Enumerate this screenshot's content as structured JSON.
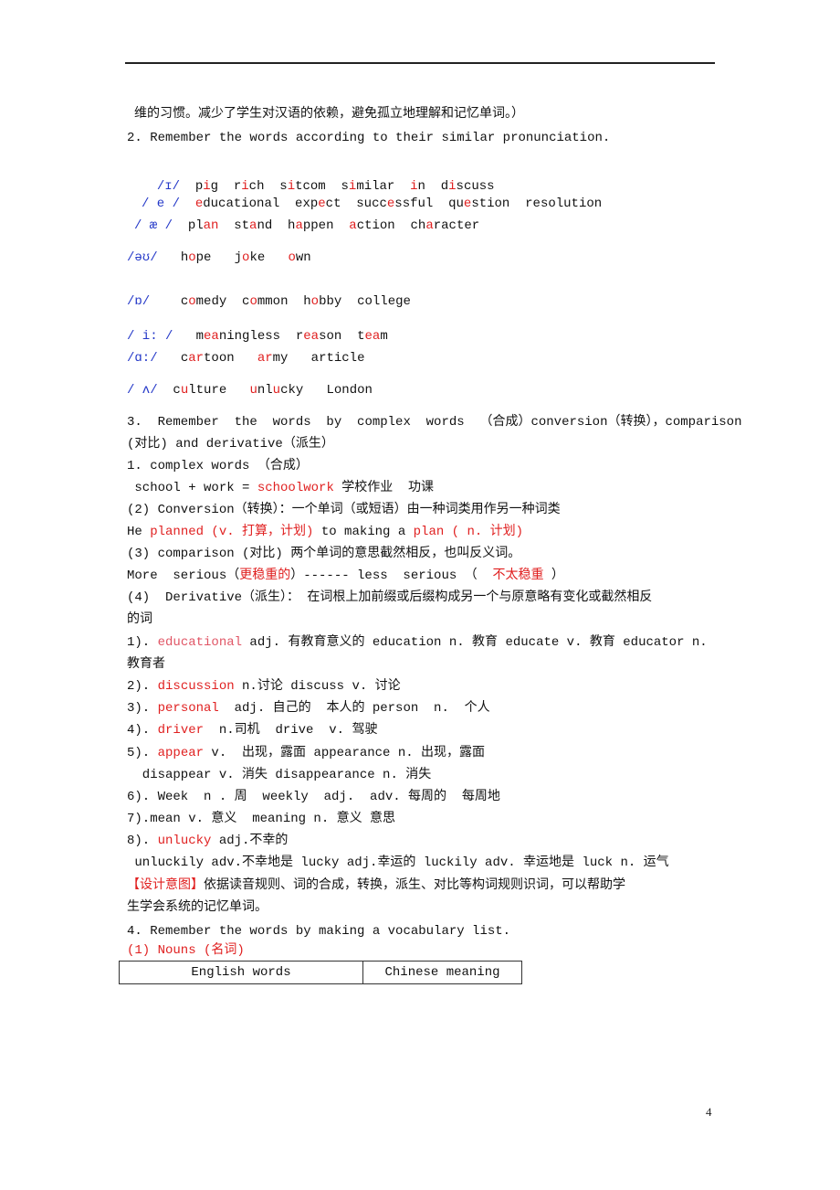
{
  "intro_tail": "维的习惯。减少了学生对汉语的依赖，避免孤立地理解和记忆单词。）",
  "section2": {
    "title": "2. Remember the words according to their similar pronunciation.",
    "rows": [
      {
        "symbol": "/ɪ/",
        "words": [
          [
            "p",
            "i",
            "g"
          ],
          [
            "r",
            "i",
            "ch"
          ],
          [
            "s",
            "i",
            "tcom"
          ],
          [
            "s",
            "i",
            "milar"
          ],
          [
            "",
            "i",
            "n"
          ],
          [
            "d",
            "i",
            "scuss"
          ]
        ]
      },
      {
        "symbol": "/ e /",
        "words": [
          [
            "",
            "e",
            "ducational"
          ],
          [
            "exp",
            "e",
            "ct"
          ],
          [
            "succ",
            "e",
            "ssful"
          ],
          [
            "qu",
            "e",
            "stion"
          ],
          [
            "resolution",
            "",
            ""
          ]
        ]
      },
      {
        "symbol": "/ æ /",
        "words": [
          [
            "pl",
            "an",
            ""
          ],
          [
            "st",
            "a",
            "nd"
          ],
          [
            "h",
            "a",
            "ppen"
          ],
          [
            "",
            "a",
            "ction"
          ],
          [
            "ch",
            "a",
            "racter"
          ]
        ]
      },
      {
        "symbol": "/əʊ/",
        "words": [
          [
            "h",
            "o",
            "pe"
          ],
          [
            "j",
            "o",
            "ke"
          ],
          [
            "",
            "o",
            "wn"
          ]
        ]
      },
      {
        "symbol": "/ɒ/",
        "words": [
          [
            "c",
            "o",
            "medy"
          ],
          [
            "c",
            "o",
            "mmon"
          ],
          [
            "h",
            "o",
            "bby"
          ],
          [
            "college",
            "",
            ""
          ]
        ]
      },
      {
        "symbol": "/ i: /",
        "words": [
          [
            "m",
            "ea",
            "ningless"
          ],
          [
            "r",
            "ea",
            "son"
          ],
          [
            "t",
            "ea",
            "m"
          ]
        ]
      },
      {
        "symbol": "/ɑ:/",
        "words": [
          [
            "c",
            "ar",
            "toon"
          ],
          [
            "",
            "ar",
            "my"
          ],
          [
            "article",
            "",
            ""
          ]
        ]
      },
      {
        "symbol": "/ ʌ/",
        "words": [
          [
            "c",
            "u",
            "lture"
          ],
          [
            "",
            "u",
            "nl"
          ],
          [
            "u",
            "",
            ""
          ],
          [
            "London",
            "",
            ""
          ]
        ]
      }
    ]
  },
  "section3": {
    "title_line1": "3.  Remember  the  words  by  complex  words  （合成）conversion（转换），comparison",
    "title_line2": "(对比) and derivative（派生）",
    "complex_heading": "1. complex words （合成）",
    "complex_example": {
      "pre": " school + work = ",
      "red": "schoolwork",
      "post": " 学校作业  功课"
    },
    "conversion_heading": "(2) Conversion（转换）：一个单词（或短语）由一种词类用作另一种词类",
    "conversion_example": {
      "pre": "He ",
      "red1": "planned (v. 打算，计划)",
      "mid": " to making a ",
      "red2": "plan ( n. 计划)"
    },
    "comparison_heading": "(3) comparison (对比) 两个单词的意思截然相反，也叫反义词。",
    "comparison_example": {
      "pre": "More  serious（",
      "red1": "更稳重的",
      "mid": "）------ less  serious （  ",
      "red2": "不太稳重",
      "post": " ）"
    },
    "derivative_heading_line1": "(4)  Derivative（派生）： 在词根上加前缀或后缀构成另一个与原意略有变化或截然相反",
    "derivative_heading_line2": "的词",
    "derivatives": [
      {
        "num": "1). ",
        "word": "educational",
        "rest": " adj. 有教育意义的 education n. 教育 educate v. 教育 educator n.",
        "cont": "教育者"
      },
      {
        "num": "2). ",
        "word": "discussion",
        "rest": " n.讨论 discuss v. 讨论"
      },
      {
        "num": "3). ",
        "word": "personal",
        "rest": "  adj. 自己的  本人的 person  n.  个人"
      },
      {
        "num": "4). ",
        "word": "driver",
        "rest": "  n.司机  drive  v. 驾驶"
      },
      {
        "num": "5). ",
        "word": "appear",
        "rest": " v.  出现，露面 appearance n. 出现，露面",
        "cont": "  disappear v. 消失 disappearance n. 消失"
      },
      {
        "num": "6). Week  n . 周  weekly  adj.  adv. 每周的  每周地",
        "word": "",
        "rest": ""
      },
      {
        "num": "7).mean v. 意义  meaning n. 意义 意思",
        "word": "",
        "rest": ""
      },
      {
        "num": "8). ",
        "word": "unlucky",
        "rest": " adj.不幸的",
        "cont": " unluckily adv.不幸地是 lucky adj.幸运的 luckily adv. 幸运地是 luck n. 运气"
      }
    ]
  },
  "design_intent": {
    "label": "【设计意图】",
    "text_line1": "依据读音规则、词的合成，转换，派生、对比等构词规则识词，可以帮助学",
    "text_line2": "生学会系统的记忆单词。"
  },
  "section4": {
    "title": "4. Remember the words by making a vocabulary list.",
    "subheading": "(1) Nouns (名词)",
    "table_headers": [
      "English words",
      "Chinese meaning"
    ]
  },
  "page_number": "4",
  "colors": {
    "highlight_red": "#e02020",
    "phonetic_blue": "#2438c8"
  }
}
